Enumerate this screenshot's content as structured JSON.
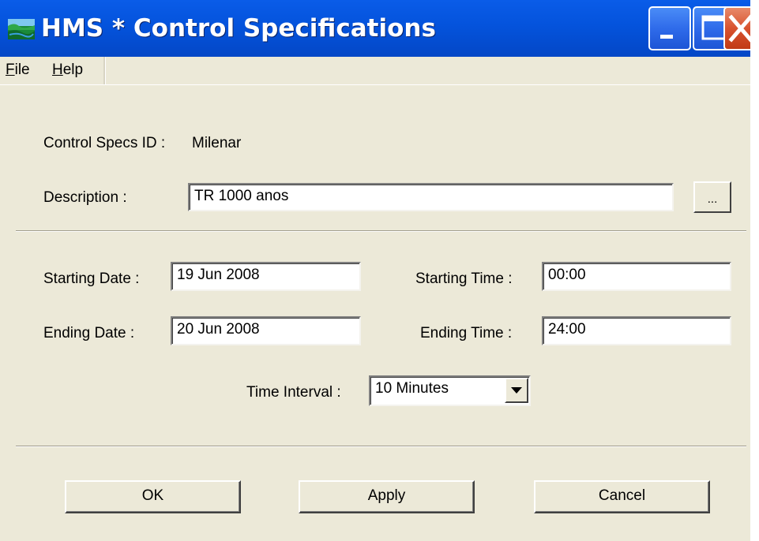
{
  "window": {
    "title": "HMS * Control Specifications",
    "controls": {
      "minimize": "minimize-icon",
      "maximize": "maximize-icon",
      "close": "close-icon"
    }
  },
  "menu": {
    "file": {
      "accel": "F",
      "rest": "ile"
    },
    "help": {
      "accel": "H",
      "rest": "elp"
    }
  },
  "form": {
    "control_specs_id_label": "Control Specs ID :",
    "control_specs_id_value": "Milenar",
    "description_label": "Description :",
    "description_value": "TR 1000 anos",
    "browse_button": "...",
    "starting_date_label": "Starting Date :",
    "starting_date_value": "19 Jun 2008",
    "ending_date_label": "Ending Date :",
    "ending_date_value": "20 Jun 2008",
    "starting_time_label": "Starting Time :",
    "starting_time_value": "00:00",
    "ending_time_label": "Ending Time :",
    "ending_time_value": "24:00",
    "time_interval_label": "Time Interval :",
    "time_interval_value": "10 Minutes"
  },
  "buttons": {
    "ok": "OK",
    "apply": "Apply",
    "cancel": "Cancel"
  },
  "colors": {
    "titlebar": "#0453dc",
    "dialog_bg": "#ece9d8",
    "close_button": "#d8522e"
  }
}
